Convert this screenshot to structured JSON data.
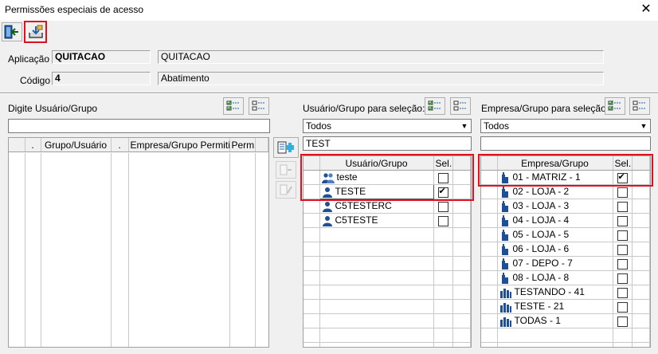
{
  "window": {
    "title": "Permissões especiais de acesso"
  },
  "form": {
    "aplicacao_label": "Aplicação",
    "aplicacao_code": "QUITACAO",
    "aplicacao_desc": "QUITACAO",
    "codigo_label": "Código",
    "codigo_value": "4",
    "codigo_desc": "Abatimento"
  },
  "left": {
    "label": "Digite Usuário/Grupo",
    "input_value": "",
    "columns": [
      ".",
      "Grupo/Usuário",
      ".",
      "Empresa/Grupo Permitido",
      "Perm."
    ]
  },
  "users": {
    "label": "Usuário/Grupo para seleção:",
    "filter_selected": "Todos",
    "search_value": "TEST",
    "columns": [
      "Usuário/Grupo",
      "Sel."
    ],
    "rows": [
      {
        "name": "teste",
        "icon": "group-icon",
        "checked": false
      },
      {
        "name": "TESTE",
        "icon": "user-icon",
        "checked": true
      },
      {
        "name": "C5TESTERC",
        "icon": "user-icon",
        "checked": false
      },
      {
        "name": "C5TESTE",
        "icon": "user-icon",
        "checked": false
      }
    ]
  },
  "companies": {
    "label": "Empresa/Grupo para seleção:",
    "filter_selected": "Todos",
    "search_value": "",
    "columns": [
      "Empresa/Grupo",
      "Sel."
    ],
    "rows": [
      {
        "name": "01 - MATRIZ - 1",
        "icon": "building-icon",
        "checked": true
      },
      {
        "name": "02 - LOJA - 2",
        "icon": "building-icon",
        "checked": false
      },
      {
        "name": "03 - LOJA - 3",
        "icon": "building-icon",
        "checked": false
      },
      {
        "name": "04 - LOJA - 4",
        "icon": "building-icon",
        "checked": false
      },
      {
        "name": "05 - LOJA - 5",
        "icon": "building-icon",
        "checked": false
      },
      {
        "name": "06 - LOJA - 6",
        "icon": "building-icon",
        "checked": false
      },
      {
        "name": "07 - DEPO - 7",
        "icon": "building-icon",
        "checked": false
      },
      {
        "name": "08 - LOJA - 8",
        "icon": "building-icon",
        "checked": false
      },
      {
        "name": "TESTANDO - 41",
        "icon": "building-group-icon",
        "checked": false
      },
      {
        "name": "TESTE - 21",
        "icon": "building-group-icon",
        "checked": false
      },
      {
        "name": "TODAS - 1",
        "icon": "building-group-icon",
        "checked": false
      }
    ]
  },
  "colors": {
    "highlight": "#e0101e",
    "accent": "#1f6fb5",
    "icon_green": "#2e8b3a"
  }
}
